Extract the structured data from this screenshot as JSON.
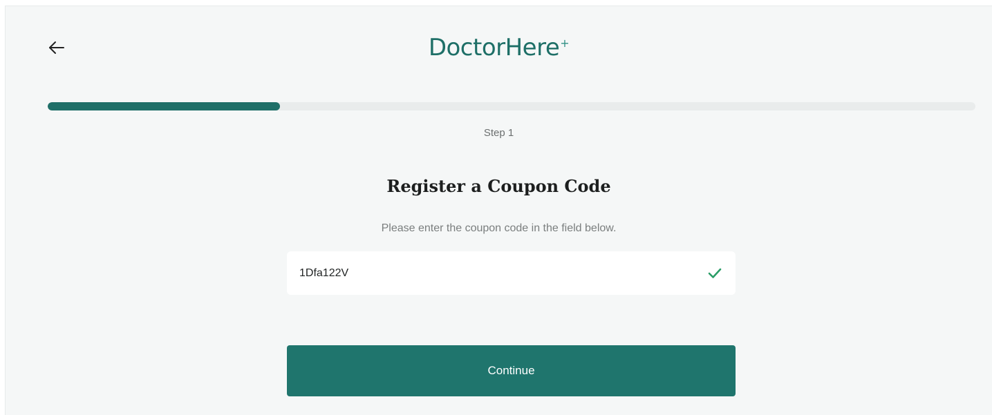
{
  "header": {
    "brand_name": "DoctorHere",
    "brand_mark": "+",
    "back_icon": "arrow-left-icon"
  },
  "progress": {
    "fraction": 0.25,
    "color": "#1f6f68",
    "track_color": "#e9ecec"
  },
  "step": {
    "label": "Step 1"
  },
  "form": {
    "title": "Register a Coupon Code",
    "instructions": "Please enter the coupon code in the field below.",
    "coupon_value": "1Dfa122V",
    "valid_icon": "check-icon",
    "valid_color": "#2a9d67",
    "continue_label": "Continue",
    "button_color": "#1f756d"
  }
}
